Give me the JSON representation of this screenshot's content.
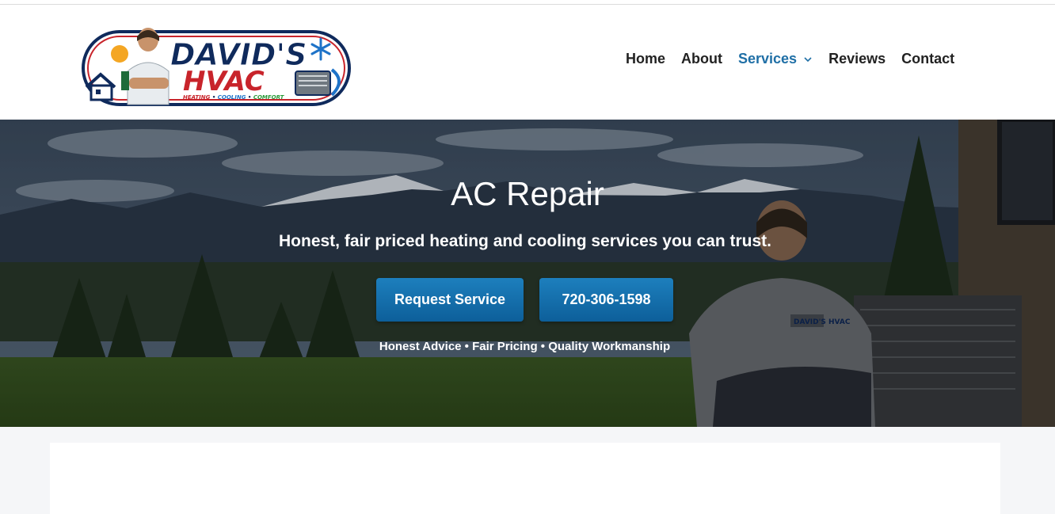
{
  "header": {
    "logo": {
      "brand_line1": "DAVID'S",
      "brand_line2": "HVAC",
      "tagline_words": [
        "HEATING",
        "COOLING",
        "COMFORT"
      ],
      "colors": {
        "navy": "#0f2a5c",
        "red": "#c8242b",
        "blue": "#1e73c8"
      }
    },
    "nav": {
      "items": [
        {
          "label": "Home"
        },
        {
          "label": "About"
        },
        {
          "label": "Services",
          "has_dropdown": true,
          "active": true
        },
        {
          "label": "Reviews"
        },
        {
          "label": "Contact"
        }
      ]
    }
  },
  "hero": {
    "title": "AC Repair",
    "subtitle": "Honest, fair priced heating and cooling services you can trust.",
    "buttons": {
      "request": "Request Service",
      "phone": "720-306-1598"
    },
    "tagline": "Honest Advice • Fair Pricing • Quality Workmanship",
    "shirt_logo": "DAVID'S HVAC"
  },
  "colors": {
    "accent": "#1f6fa6",
    "button": "#1673b3",
    "text": "#222222",
    "page_bg": "#f5f6f8"
  }
}
